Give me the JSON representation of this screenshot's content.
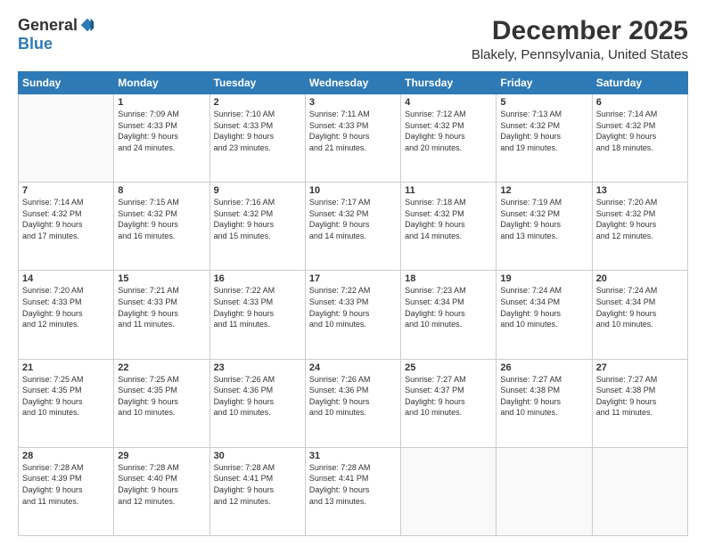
{
  "logo": {
    "general": "General",
    "blue": "Blue"
  },
  "title": "December 2025",
  "subtitle": "Blakely, Pennsylvania, United States",
  "header": {
    "days": [
      "Sunday",
      "Monday",
      "Tuesday",
      "Wednesday",
      "Thursday",
      "Friday",
      "Saturday"
    ]
  },
  "weeks": [
    [
      {
        "num": "",
        "info": ""
      },
      {
        "num": "1",
        "info": "Sunrise: 7:09 AM\nSunset: 4:33 PM\nDaylight: 9 hours\nand 24 minutes."
      },
      {
        "num": "2",
        "info": "Sunrise: 7:10 AM\nSunset: 4:33 PM\nDaylight: 9 hours\nand 23 minutes."
      },
      {
        "num": "3",
        "info": "Sunrise: 7:11 AM\nSunset: 4:33 PM\nDaylight: 9 hours\nand 21 minutes."
      },
      {
        "num": "4",
        "info": "Sunrise: 7:12 AM\nSunset: 4:32 PM\nDaylight: 9 hours\nand 20 minutes."
      },
      {
        "num": "5",
        "info": "Sunrise: 7:13 AM\nSunset: 4:32 PM\nDaylight: 9 hours\nand 19 minutes."
      },
      {
        "num": "6",
        "info": "Sunrise: 7:14 AM\nSunset: 4:32 PM\nDaylight: 9 hours\nand 18 minutes."
      }
    ],
    [
      {
        "num": "7",
        "info": "Sunrise: 7:14 AM\nSunset: 4:32 PM\nDaylight: 9 hours\nand 17 minutes."
      },
      {
        "num": "8",
        "info": "Sunrise: 7:15 AM\nSunset: 4:32 PM\nDaylight: 9 hours\nand 16 minutes."
      },
      {
        "num": "9",
        "info": "Sunrise: 7:16 AM\nSunset: 4:32 PM\nDaylight: 9 hours\nand 15 minutes."
      },
      {
        "num": "10",
        "info": "Sunrise: 7:17 AM\nSunset: 4:32 PM\nDaylight: 9 hours\nand 14 minutes."
      },
      {
        "num": "11",
        "info": "Sunrise: 7:18 AM\nSunset: 4:32 PM\nDaylight: 9 hours\nand 14 minutes."
      },
      {
        "num": "12",
        "info": "Sunrise: 7:19 AM\nSunset: 4:32 PM\nDaylight: 9 hours\nand 13 minutes."
      },
      {
        "num": "13",
        "info": "Sunrise: 7:20 AM\nSunset: 4:32 PM\nDaylight: 9 hours\nand 12 minutes."
      }
    ],
    [
      {
        "num": "14",
        "info": "Sunrise: 7:20 AM\nSunset: 4:33 PM\nDaylight: 9 hours\nand 12 minutes."
      },
      {
        "num": "15",
        "info": "Sunrise: 7:21 AM\nSunset: 4:33 PM\nDaylight: 9 hours\nand 11 minutes."
      },
      {
        "num": "16",
        "info": "Sunrise: 7:22 AM\nSunset: 4:33 PM\nDaylight: 9 hours\nand 11 minutes."
      },
      {
        "num": "17",
        "info": "Sunrise: 7:22 AM\nSunset: 4:33 PM\nDaylight: 9 hours\nand 10 minutes."
      },
      {
        "num": "18",
        "info": "Sunrise: 7:23 AM\nSunset: 4:34 PM\nDaylight: 9 hours\nand 10 minutes."
      },
      {
        "num": "19",
        "info": "Sunrise: 7:24 AM\nSunset: 4:34 PM\nDaylight: 9 hours\nand 10 minutes."
      },
      {
        "num": "20",
        "info": "Sunrise: 7:24 AM\nSunset: 4:34 PM\nDaylight: 9 hours\nand 10 minutes."
      }
    ],
    [
      {
        "num": "21",
        "info": "Sunrise: 7:25 AM\nSunset: 4:35 PM\nDaylight: 9 hours\nand 10 minutes."
      },
      {
        "num": "22",
        "info": "Sunrise: 7:25 AM\nSunset: 4:35 PM\nDaylight: 9 hours\nand 10 minutes."
      },
      {
        "num": "23",
        "info": "Sunrise: 7:26 AM\nSunset: 4:36 PM\nDaylight: 9 hours\nand 10 minutes."
      },
      {
        "num": "24",
        "info": "Sunrise: 7:26 AM\nSunset: 4:36 PM\nDaylight: 9 hours\nand 10 minutes."
      },
      {
        "num": "25",
        "info": "Sunrise: 7:27 AM\nSunset: 4:37 PM\nDaylight: 9 hours\nand 10 minutes."
      },
      {
        "num": "26",
        "info": "Sunrise: 7:27 AM\nSunset: 4:38 PM\nDaylight: 9 hours\nand 10 minutes."
      },
      {
        "num": "27",
        "info": "Sunrise: 7:27 AM\nSunset: 4:38 PM\nDaylight: 9 hours\nand 11 minutes."
      }
    ],
    [
      {
        "num": "28",
        "info": "Sunrise: 7:28 AM\nSunset: 4:39 PM\nDaylight: 9 hours\nand 11 minutes."
      },
      {
        "num": "29",
        "info": "Sunrise: 7:28 AM\nSunset: 4:40 PM\nDaylight: 9 hours\nand 12 minutes."
      },
      {
        "num": "30",
        "info": "Sunrise: 7:28 AM\nSunset: 4:41 PM\nDaylight: 9 hours\nand 12 minutes."
      },
      {
        "num": "31",
        "info": "Sunrise: 7:28 AM\nSunset: 4:41 PM\nDaylight: 9 hours\nand 13 minutes."
      },
      {
        "num": "",
        "info": ""
      },
      {
        "num": "",
        "info": ""
      },
      {
        "num": "",
        "info": ""
      }
    ]
  ]
}
